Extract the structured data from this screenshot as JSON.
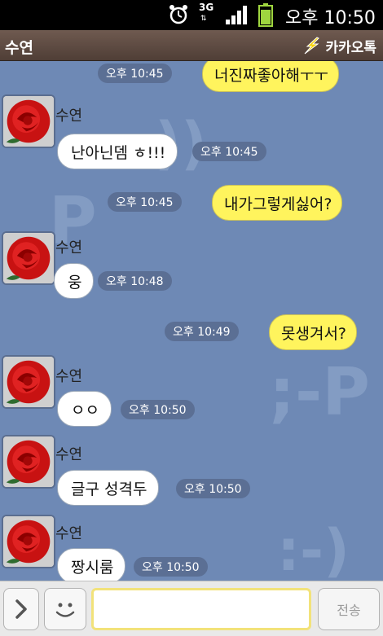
{
  "status_bar": {
    "network": "3G",
    "time": "오후 10:50",
    "icons": [
      "alarm-icon",
      "3g-data-icon",
      "signal-icon",
      "battery-icon"
    ]
  },
  "title_bar": {
    "contact_name": "수연",
    "app_name": "카카오톡",
    "brand_color": "#f5d000"
  },
  "colors": {
    "chat_background": "#6e89b5",
    "my_bubble": "#fff45d",
    "their_bubble": "#ffffff"
  },
  "messages": [
    {
      "from": "me",
      "text": "너진짜좋아해ㅜㅜ",
      "time": "오후 10:45"
    },
    {
      "from": "수연",
      "sender_label": "수연",
      "text": "난아닌뎀 ㅎ!!!",
      "time": "오후 10:45"
    },
    {
      "from": "me",
      "text": "내가그렇게싫어?",
      "time": "오후 10:45"
    },
    {
      "from": "수연",
      "sender_label": "수연",
      "text": "웅",
      "time": "오후 10:48"
    },
    {
      "from": "me",
      "text": "못생겨서?",
      "time": "오후 10:49"
    },
    {
      "from": "수연",
      "sender_label": "수연",
      "text": "ㅇㅇ",
      "time": "오후 10:50"
    },
    {
      "from": "수연",
      "sender_label": "수연",
      "text": "글구 성격두",
      "time": "오후 10:50"
    },
    {
      "from": "수연",
      "sender_label": "수연",
      "text": "짱시룸",
      "time": "오후 10:50"
    }
  ],
  "input_bar": {
    "message_value": "",
    "send_label": "전송"
  }
}
